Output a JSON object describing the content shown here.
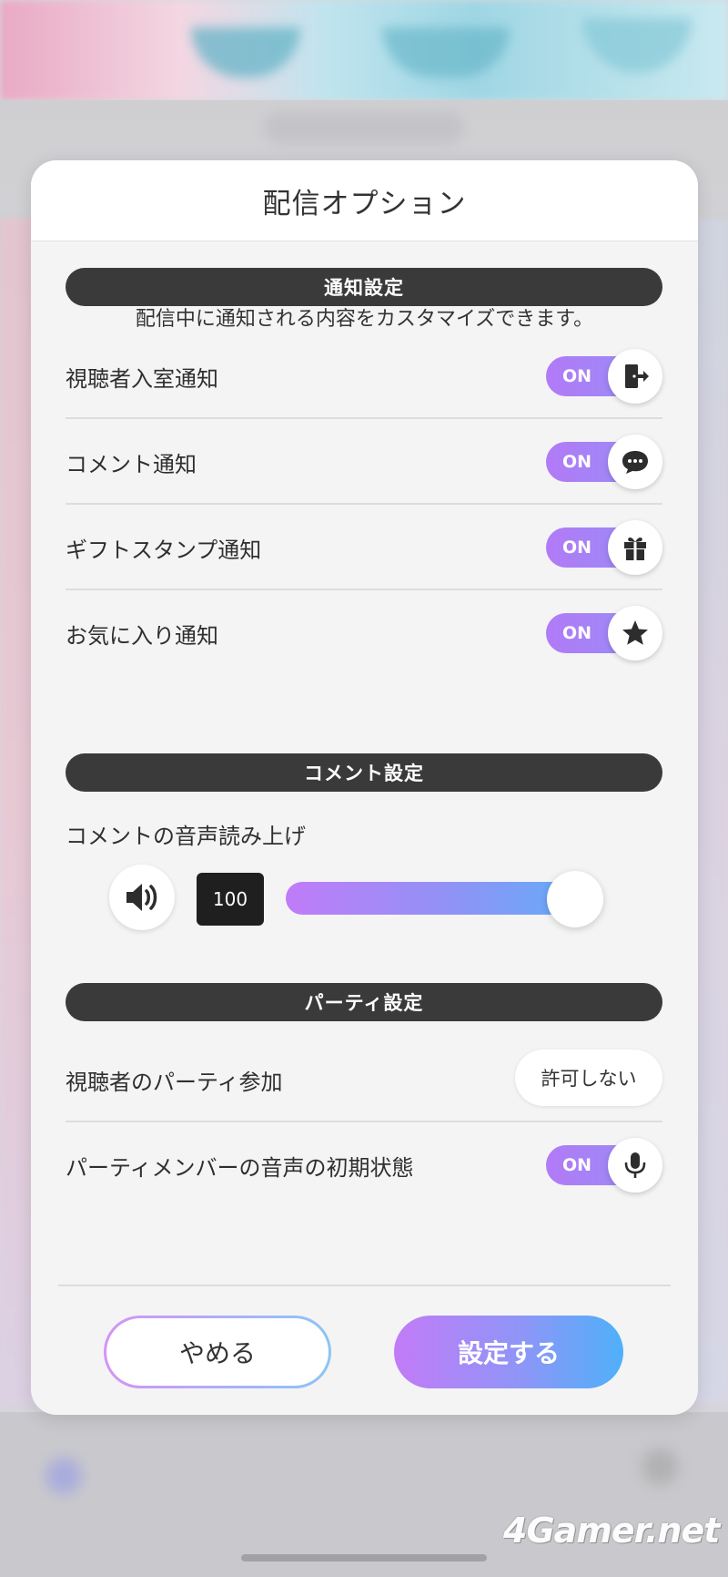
{
  "dialog": {
    "title": "配信オプション",
    "notification_section": {
      "header": "通知設定",
      "description": "配信中に通知される内容をカスタマイズできます。",
      "items": [
        {
          "label": "視聴者入室通知",
          "toggle": "ON",
          "icon": "door-enter-icon"
        },
        {
          "label": "コメント通知",
          "toggle": "ON",
          "icon": "chat-bubble-icon"
        },
        {
          "label": "ギフトスタンプ通知",
          "toggle": "ON",
          "icon": "gift-icon"
        },
        {
          "label": "お気に入り通知",
          "toggle": "ON",
          "icon": "star-icon"
        }
      ]
    },
    "comment_section": {
      "header": "コメント設定",
      "tts_label": "コメントの音声読み上げ",
      "volume_value": "100",
      "volume_level": 1.0,
      "icon": "speaker-icon"
    },
    "party_section": {
      "header": "パーティ設定",
      "viewer_join_label": "視聴者のパーティ参加",
      "viewer_join_value": "許可しない",
      "member_voice_label": "パーティメンバーの音声の初期状態",
      "member_voice_toggle": "ON",
      "member_voice_icon": "microphone-icon"
    },
    "buttons": {
      "cancel": "やめる",
      "confirm": "設定する"
    }
  },
  "watermark": "4Gamer.net",
  "colors": {
    "accent_purple": "#b27af7",
    "accent_blue": "#4fb0f9",
    "section_bar": "#3a3a3a"
  }
}
